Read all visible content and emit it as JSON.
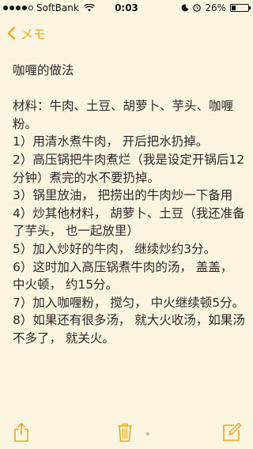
{
  "status_bar": {
    "carrier": "SoftBank",
    "time": "0:03",
    "battery": "26%",
    "battery_level": 0.26,
    "signal_bars": 5,
    "signal_filled": 4
  },
  "nav": {
    "back_label": "メモ",
    "accent": "#e6a91b"
  },
  "note": {
    "title": "咖喱的做法",
    "lines": [
      "材料：牛肉、土豆、胡萝卜、芋头、咖喱粉。",
      "1）用清水煮牛肉， 开后把水扔掉。",
      "2）高压锅把牛肉煮烂（我是设定开锅后12分钟）煮完的水不要扔掉。",
      "3）锅里放油， 把捞出的牛肉炒一下备用",
      "4）炒其他材料， 胡萝卜、土豆（我还准备了芋头， 也一起放里）",
      "5）加入炒好的牛肉， 继续炒约3分。",
      "6）这时加入高压锅煮牛肉的汤， 盖盖， 中火顿， 约15分。",
      "7）加入咖喱粉， 搅匀， 中火继续顿5分。",
      "8）如果还有很多汤， 就大火收汤，如果汤不多了， 就关火。"
    ]
  },
  "toolbar": {
    "icons": [
      "share-icon",
      "trash-icon",
      "compose-icon"
    ]
  }
}
